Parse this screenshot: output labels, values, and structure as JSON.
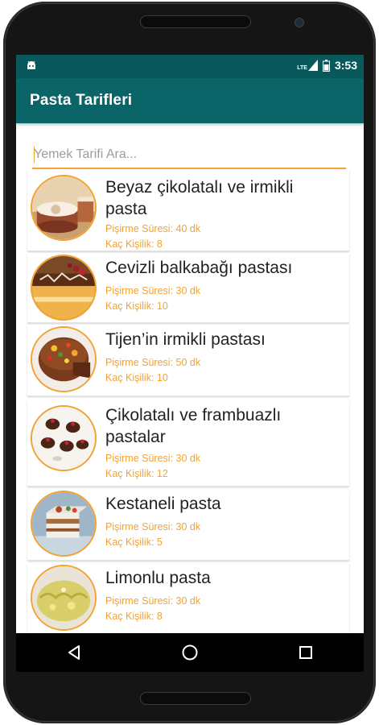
{
  "status": {
    "time": "3:53",
    "network": "LTE"
  },
  "app": {
    "title": "Pasta Tarifleri"
  },
  "search": {
    "placeholder": "Yemek Tarifi Ara..."
  },
  "recipes": [
    {
      "title": "Beyaz çikolatalı ve irmikli pasta",
      "time": "Pişirme Süresi: 40 dk",
      "servings": "Kaç Kişilik: 8"
    },
    {
      "title": "Cevizli balkabağı pastası",
      "time": "Pişirme Süresi: 30 dk",
      "servings": "Kaç Kişilik: 10"
    },
    {
      "title": "Tijen’in irmikli pastası",
      "time": "Pişirme Süresi: 50 dk",
      "servings": "Kaç Kişilik: 10"
    },
    {
      "title": "Çikolatalı ve frambuazlı pastalar",
      "time": "Pişirme Süresi: 30 dk",
      "servings": "Kaç Kişilik: 12"
    },
    {
      "title": "Kestaneli pasta",
      "time": "Pişirme Süresi: 30 dk",
      "servings": "Kaç Kişilik: 5"
    },
    {
      "title": "Limonlu pasta",
      "time": "Pişirme Süresi: 30 dk",
      "servings": "Kaç Kişilik: 8"
    }
  ],
  "colors": {
    "primary": "#0b6468",
    "status_bar": "#08585c",
    "accent": "#f3a234"
  },
  "icons": {
    "back": "back-triangle-icon",
    "home": "home-circle-icon",
    "recents": "recents-square-icon"
  }
}
